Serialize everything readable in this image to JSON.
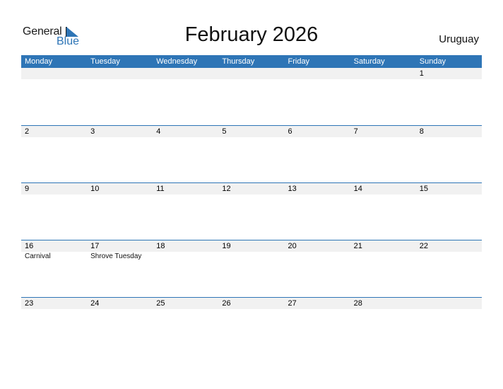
{
  "logo": {
    "word1": "General",
    "word2": "Blue"
  },
  "title": "February 2026",
  "country": "Uruguay",
  "colors": {
    "accent": "#2e75b6",
    "date_bar": "#f1f1f1"
  },
  "weekdays": [
    "Monday",
    "Tuesday",
    "Wednesday",
    "Thursday",
    "Friday",
    "Saturday",
    "Sunday"
  ],
  "weeks": [
    [
      {
        "d": ""
      },
      {
        "d": ""
      },
      {
        "d": ""
      },
      {
        "d": ""
      },
      {
        "d": ""
      },
      {
        "d": ""
      },
      {
        "d": "1"
      }
    ],
    [
      {
        "d": "2"
      },
      {
        "d": "3"
      },
      {
        "d": "4"
      },
      {
        "d": "5"
      },
      {
        "d": "6"
      },
      {
        "d": "7"
      },
      {
        "d": "8"
      }
    ],
    [
      {
        "d": "9"
      },
      {
        "d": "10"
      },
      {
        "d": "11"
      },
      {
        "d": "12"
      },
      {
        "d": "13"
      },
      {
        "d": "14"
      },
      {
        "d": "15"
      }
    ],
    [
      {
        "d": "16",
        "h": "Carnival"
      },
      {
        "d": "17",
        "h": "Shrove Tuesday"
      },
      {
        "d": "18"
      },
      {
        "d": "19"
      },
      {
        "d": "20"
      },
      {
        "d": "21"
      },
      {
        "d": "22"
      }
    ],
    [
      {
        "d": "23"
      },
      {
        "d": "24"
      },
      {
        "d": "25"
      },
      {
        "d": "26"
      },
      {
        "d": "27"
      },
      {
        "d": "28"
      },
      {
        "d": ""
      }
    ]
  ]
}
